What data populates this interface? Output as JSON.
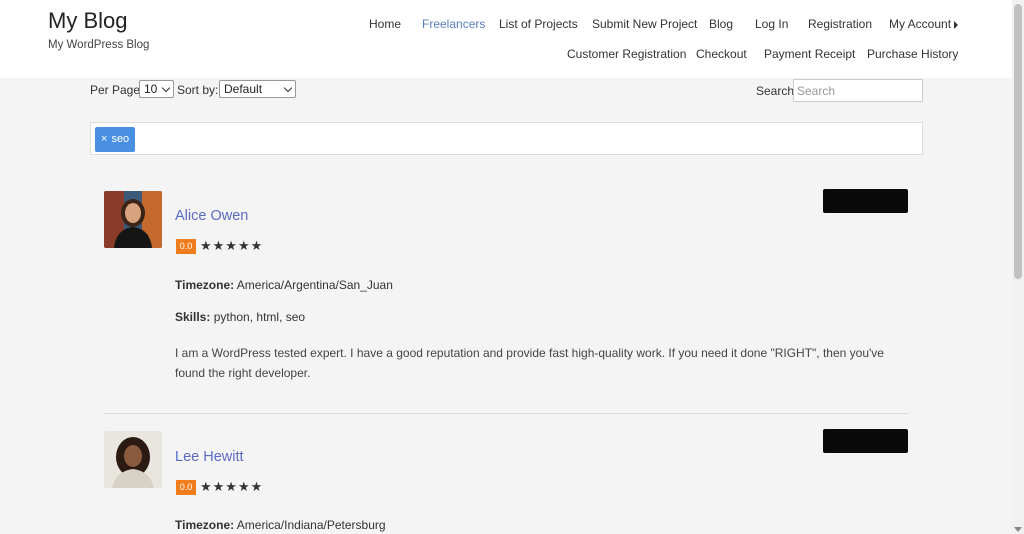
{
  "site": {
    "title": "My Blog",
    "description": "My WordPress Blog"
  },
  "nav": {
    "row1": [
      "Home",
      "Freelancers",
      "List of Projects",
      "Submit New Project",
      "Blog",
      "Log In",
      "Registration",
      "My Account"
    ],
    "row2": [
      "Customer Registration",
      "Checkout",
      "Payment Receipt",
      "Purchase History"
    ],
    "active": "Freelancers"
  },
  "controls": {
    "per_page_label": "Per Page:",
    "per_page_value": "10",
    "sort_label": "Sort by:",
    "sort_value": "Default",
    "search_label": "Search",
    "search_placeholder": "Search"
  },
  "filter": {
    "tags": [
      {
        "remove": "×",
        "label": "seo"
      }
    ]
  },
  "freelancers": [
    {
      "name": "Alice Owen",
      "rating": "0.0",
      "stars": "★★★★★",
      "timezone_label": "Timezone:",
      "timezone": "America/Argentina/San_Juan",
      "skills_label": "Skills:",
      "skills": "python, html, seo",
      "bio": "I am a WordPress tested expert. I have a good reputation and provide fast high-quality work. If you need it done \"RIGHT\", then you've found the right developer."
    },
    {
      "name": "Lee Hewitt",
      "rating": "0.0",
      "stars": "★★★★★",
      "timezone_label": "Timezone:",
      "timezone": "America/Indiana/Petersburg"
    }
  ],
  "colors": {
    "accent": "#5a7dc4",
    "name_link": "#5b6bc4",
    "rating_badge": "#f07c1b",
    "tag": "#4a90e2"
  }
}
